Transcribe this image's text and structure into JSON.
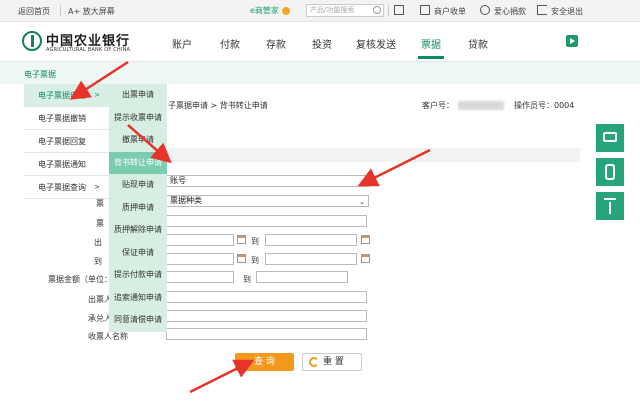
{
  "topbar": {
    "home": "返回首页",
    "zoom": "A+ 放大屏幕",
    "e_steward": "e商管家",
    "search_placeholder": "产品/功能搜索",
    "merchant": "商户收单",
    "donate": "爱心捐款",
    "logout": "安全退出"
  },
  "logo": {
    "cn": "中国农业银行",
    "en": "AGRICULTURAL BANK OF CHINA"
  },
  "nav": [
    "账户",
    "付款",
    "存款",
    "投资",
    "复核发送",
    "票据",
    "贷款"
  ],
  "nav_active": "票据",
  "breadcrumb_bar": "电子票据",
  "left_menu": [
    {
      "label": "电子票据申请",
      "arrow": ">"
    },
    {
      "label": "电子票据撤销",
      "arrow": ""
    },
    {
      "label": "电子票据回复",
      "arrow": ""
    },
    {
      "label": "电子票据通知",
      "arrow": ""
    },
    {
      "label": "电子票据查询",
      "arrow": ">"
    }
  ],
  "sub_menu": [
    "出票申请",
    "提示收票申请",
    "撤票申请",
    "背书转让申请",
    "贴现申请",
    "质押申请",
    "质押解除申请",
    "保证申请",
    "提示付款申请",
    "追索通知申请",
    "同意清偿申请"
  ],
  "sub_menu_active": "背书转让申请",
  "content": {
    "crumb": "子票据申请 > 背书转让申请",
    "customer_label": "客户号：",
    "operator": "操作员号：0004"
  },
  "form": {
    "account_value": "账号",
    "type_value": "票据种类",
    "labels": {
      "type": "票",
      "number": "票",
      "issue_date": "出",
      "due_date": "到",
      "amount": "票据金额（单位：",
      "drawer": "出票人",
      "acceptor": "承兑人",
      "payee": "收票人名称"
    },
    "to_label": "到"
  },
  "buttons": {
    "query": "查 询",
    "reset": "重 置"
  }
}
